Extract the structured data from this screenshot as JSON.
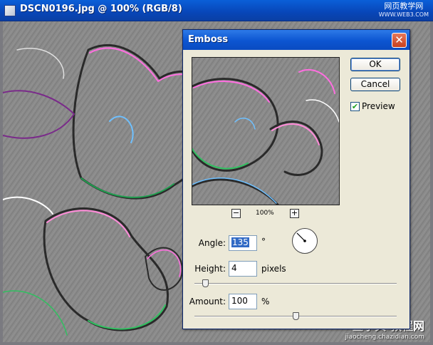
{
  "window": {
    "title": "DSCN0196.jpg @ 100% (RGB/8)",
    "watermark_top": "网页教学网",
    "watermark_top_url": "WWW.WEB3.COM",
    "watermark_bottom": "查字典 教程网",
    "watermark_bottom_url": "jiaocheng.chazidian.com"
  },
  "dialog": {
    "title": "Emboss",
    "close_glyph": "✕",
    "ok_label": "OK",
    "cancel_label": "Cancel",
    "preview_label": "Preview",
    "preview_checked": true,
    "zoom_out": "−",
    "zoom_in": "+",
    "zoom_level": "100%",
    "angle_label": "Angle:",
    "angle_value": "135",
    "angle_unit": "°",
    "height_label": "Height:",
    "height_value": "4",
    "height_unit": "pixels",
    "height_slider_fraction": 0.04,
    "amount_label": "Amount:",
    "amount_value": "100",
    "amount_unit": "%",
    "amount_slider_fraction": 0.5
  },
  "icons": {
    "close": "close-icon",
    "check": "checkmark-icon",
    "dial": "angle-dial-icon",
    "document": "document-icon"
  },
  "colors": {
    "titlebar": "#0a5fd8",
    "dialog_bg": "#ece9d8",
    "close_red": "#d0502e",
    "emboss_gray": "#8a8a8a"
  }
}
